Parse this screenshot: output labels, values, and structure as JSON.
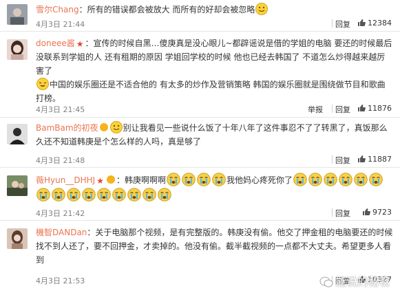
{
  "comments": [
    {
      "username": "雪尔Chang",
      "text": "：所有的错误都会被放大 而所有的好却会被忽略",
      "time": "4月3日 21:44",
      "reply": "回复",
      "likes": "12384",
      "avatar_color": "#8a8f98"
    },
    {
      "username": "doneee酱",
      "text_a": "：宣传的时候自黑…傻庚真是没心眼儿~都辟谣说是借的学姐的电脑 要还的时候最后没联系到学姐的人 还有租期的原因 学姐回学校的时候 他也已经去韩国了 不道怎么炒得越来越厉害了",
      "text_b": "中国的娱乐圈还是不适合他的 有太多的炒作及营销策略 韩国的娱乐圈就是围绕做节目和歌曲打榜。",
      "time": "4月3日 21:45",
      "report": "举报",
      "reply": "回复",
      "likes": "11876",
      "avatar_color": "#c7a6a0"
    },
    {
      "username": "BamBam的初夜",
      "text": "别让我看见一些说什么饭了十年八年了这件事忍不了了转黑了，真饭那么久还不知道韩庚是个怎么样的人吗，真是够了",
      "time": "4月3日 21:48",
      "reply": "回复",
      "likes": "11887",
      "avatar_color": "#3a3a3a"
    },
    {
      "username": "薇Hyun__DHHJ",
      "text_a": "：韩庚啊啊啊",
      "text_b": "我他妈心疼死你了",
      "time": "4月3日 21:42",
      "reply": "回复",
      "likes": "9723",
      "avatar_color": "#5b6b4a"
    },
    {
      "username": "機智DANDan",
      "text": "：关于电脑那个视频，是有完整版的。韩庚没有偷。他交了押金租的电脑要还的时候找不到人还了，要不回押金，才卖掉的。他没有偷。截半截视频的一点都不大丈夫。希望更多人看到",
      "time": "4月3日 21:53",
      "reply": "回复",
      "likes": "10327",
      "avatar_color": "#b08a76"
    }
  ],
  "watermark": "能说的秘密",
  "icons": {
    "smile": "smile-emoji-icon",
    "cry": "cry-emoji-icon",
    "like": "thumbs-up-icon"
  }
}
